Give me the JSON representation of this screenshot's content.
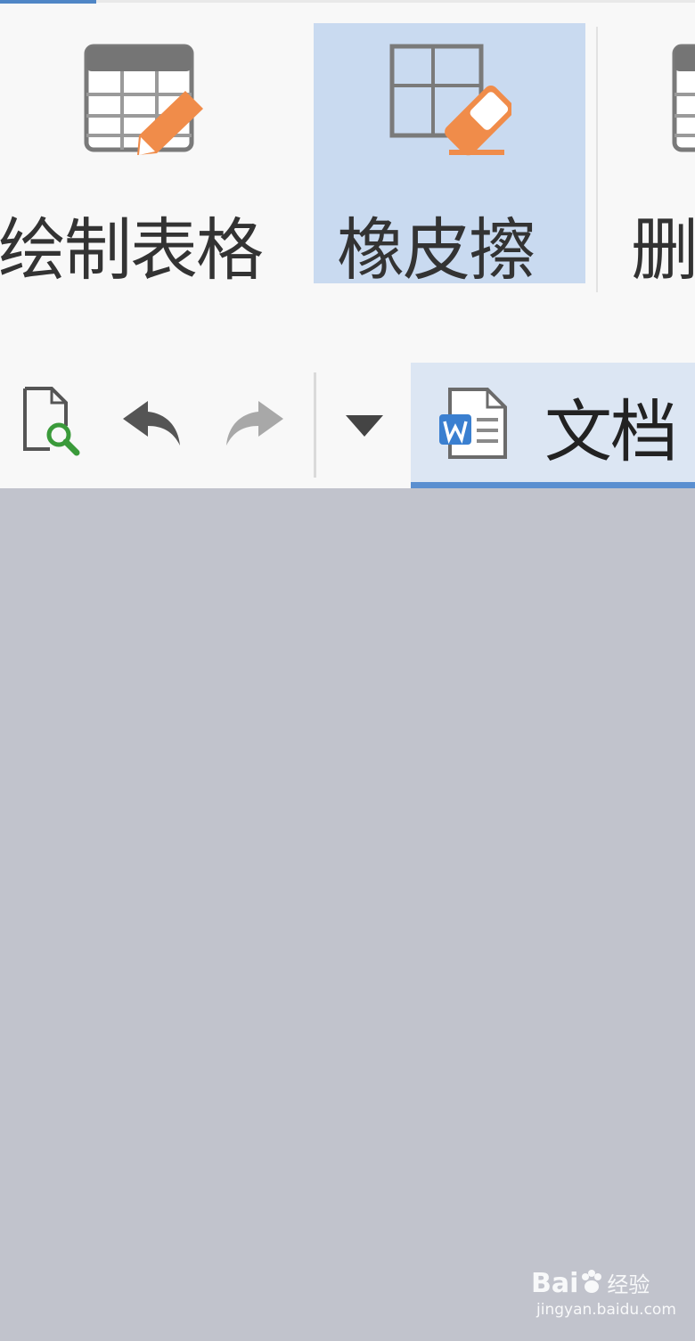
{
  "ribbon": {
    "buttons": [
      {
        "label": "绘制表格",
        "icon": "draw-table-icon"
      },
      {
        "label": "橡皮擦",
        "icon": "eraser-icon",
        "selected": true
      },
      {
        "label": "删",
        "icon": "delete-table-icon"
      }
    ]
  },
  "quick_access": {
    "items": [
      "preview-icon",
      "undo-icon",
      "redo-icon",
      "dropdown-icon"
    ]
  },
  "tab": {
    "label": "文档",
    "icon": "word-document-icon"
  },
  "watermark": {
    "brand": "Bai",
    "suffix": "经验",
    "url": "jingyan.baidu.com"
  },
  "colors": {
    "accent": "#4f86c6",
    "selected_bg": "#c9daf0",
    "pencil_orange": "#f08c4a",
    "workspace_bg": "#c1c3cc"
  }
}
